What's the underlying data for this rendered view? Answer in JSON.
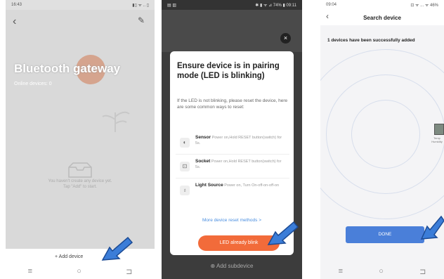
{
  "screen1": {
    "status_time": "16:43",
    "status_icons": "▮▯ ᯤ .. ▯",
    "back_icon": "‹",
    "edit_icon": "✎",
    "title": "Bluetooth gateway",
    "subtitle": "Online devices: 0",
    "empty_text": "You haven't create any device yet.\nTap \"Add\" to start.",
    "add_device_label": "+  Add device",
    "nav": [
      "≡",
      "○",
      "⊐"
    ]
  },
  "screen2": {
    "status_left": "▤ ▥",
    "status_right": "✱ ▮ ᯤ ⊿ 74% ▮ 09:11",
    "close_icon": "×",
    "dialog_title": "Ensure device is in pairing mode (LED is blinking)",
    "dialog_body": "If the LED is not blinking, please reset the device, here are some common ways to reset:",
    "methods": [
      {
        "icon": "◐",
        "name": "Sensor",
        "desc": "Power on,Hold RESET button(switch) for 5s."
      },
      {
        "icon": "⊡",
        "name": "Socket",
        "desc": "Power on,Hold RESET button(switch) for 5s."
      },
      {
        "icon": "♁",
        "name": "Light Source",
        "desc": "Power on, Turn On-off-on-off-on"
      }
    ],
    "more_link": "More device reset methods >",
    "primary_button": "LED already blink",
    "add_subdevice": "⊕ Add subdevice"
  },
  "screen3": {
    "status_time": "09:04",
    "status_icons": "⊡ ᯤ ... ᯤ 46%",
    "back_icon": "‹",
    "title": "Search device",
    "message": "1 devices have been successfully added",
    "device_label": "Temp Humidity",
    "done_button": "DONE",
    "nav": [
      "≡",
      "○",
      "⊐"
    ]
  }
}
